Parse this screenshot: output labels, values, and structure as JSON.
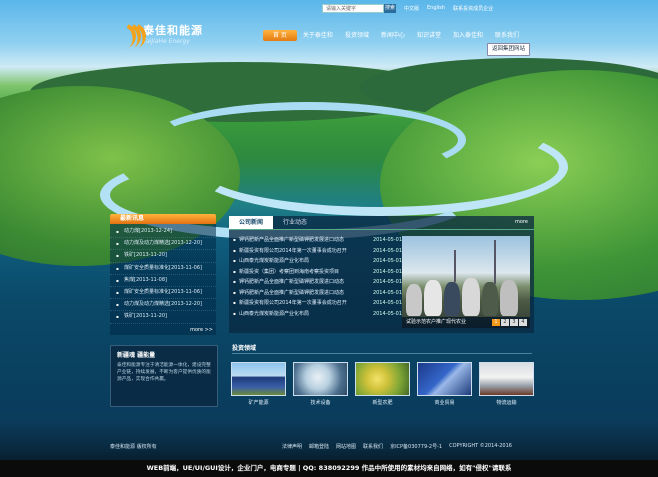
{
  "top": {
    "search_placeholder": "请输入关键字",
    "search_button": "搜索",
    "links": [
      "中文版",
      "English",
      "联系投资成员企业"
    ]
  },
  "logo": {
    "cn": "泰佳和能源",
    "en": "TaiJiaHe Energy"
  },
  "nav": {
    "items": [
      "首 页",
      "关于泰佳和",
      "投资领域",
      "新闻中心",
      "知识讲堂",
      "加入泰佳和",
      "联系我们"
    ],
    "group_button": "返回集团网站"
  },
  "side_news": {
    "title": "最新讯息",
    "items": [
      "动力煤[2013-12-24]",
      "动力煤及动力煤精选[2013-12-20]",
      "铁矿[2013-11-20]",
      "煤矿安全质量标准化[2013-11-06]",
      "焦煤[2013-11-08]",
      "煤矿安全质量标准化[2013-11-06]",
      "动力煤及动力煤精选[2013-12-20]",
      "铁矿[2013-11-20]"
    ],
    "more": "more >>"
  },
  "news": {
    "tabs": [
      "公司新闻",
      "行业动态"
    ],
    "more": "more",
    "rows": [
      {
        "title": "钾钙肥新产品全面推广新型磷钾肥发展进口动态",
        "date": "2014-05-01"
      },
      {
        "title": "新疆投资有限公司2014年第一次董事会成功召开",
        "date": "2014-05-01"
      },
      {
        "title": "山西泰光煤炭新能源产业化布局",
        "date": "2014-05-01"
      },
      {
        "title": "新疆投资（集团）考察团到海南考察投资项目",
        "date": "2014-05-01"
      },
      {
        "title": "钾钙肥新产品全面推广新型磷钾肥发展进口动态",
        "date": "2014-05-01"
      },
      {
        "title": "钾钙肥新产品全面推广新型磷钾肥发展进口动态",
        "date": "2014-05-01"
      },
      {
        "title": "新疆投资有限公司2014年第一次董事会成功召开",
        "date": "2014-05-01"
      },
      {
        "title": "山西泰光煤炭新能源产业化布局",
        "date": "2014-05-01"
      }
    ],
    "caption": "试验示范农户推广现代农业",
    "pages": [
      "1",
      "2",
      "3",
      "4"
    ]
  },
  "box2": {
    "title": "新疆魂  疆能量",
    "body": "泰佳和能源专注于清洁能源一体化，建设完整产业链，持续发展，不断为客户提供优质的能源产品，实现合作共赢。"
  },
  "invest": {
    "title": "投资领域",
    "items": [
      "矿产能源",
      "技术设备",
      "新型农肥",
      "商业贸易",
      "物流运输"
    ]
  },
  "footer": {
    "left": "泰佳和能源 版权所有",
    "links": [
      "法律声明",
      "邮箱登陆",
      "网站地图",
      "联系我们",
      "京ICP备030779-2号-1",
      "COPYRIGHT ©2014-2016"
    ],
    "bottom": "WEB前端，UE/UI/GUI设计，企业门户，电商专题 | QQ: 838092299   作品中所使用的素材均来自网络，如有\"侵权\"请联系"
  },
  "colors": {
    "accent": "#f39a1a",
    "deep": "#0a3f5f"
  }
}
